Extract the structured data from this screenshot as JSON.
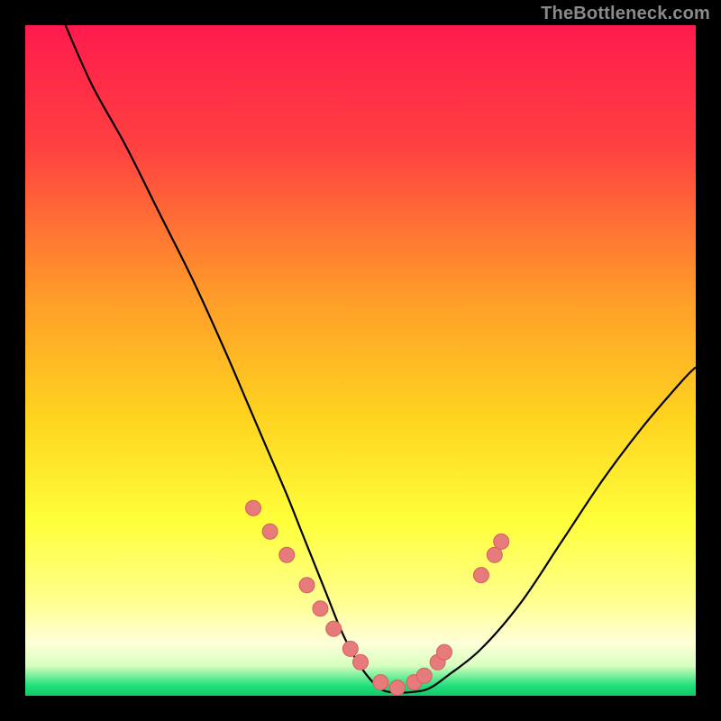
{
  "watermark": "TheBottleneck.com",
  "colors": {
    "bg_black": "#000000",
    "grad_top": "#ff1a4d",
    "grad_mid1": "#ff7a2a",
    "grad_mid2": "#ffd21f",
    "grad_mid3": "#ffff3a",
    "grad_light": "#ffffc0",
    "grad_green": "#1fe07a",
    "curve_stroke": "#000000",
    "marker_fill": "#e77a7a",
    "marker_stroke": "#d66060"
  },
  "chart_data": {
    "type": "line",
    "title": "",
    "xlabel": "",
    "ylabel": "",
    "xlim": [
      0,
      100
    ],
    "ylim": [
      0,
      100
    ],
    "x": [
      6,
      10,
      15,
      20,
      25,
      30,
      33,
      36,
      39,
      41,
      43,
      45,
      47,
      49,
      51,
      53,
      55,
      57,
      60,
      63,
      68,
      74,
      80,
      86,
      92,
      98,
      100
    ],
    "y": [
      100,
      91,
      82,
      72,
      62,
      51,
      44,
      37,
      30,
      25,
      20,
      15,
      10,
      6,
      3,
      1,
      0.5,
      0.5,
      1,
      3,
      7,
      14,
      23,
      32,
      40,
      47,
      49
    ],
    "markers_x": [
      34,
      36.5,
      39,
      42,
      44,
      46,
      48.5,
      50,
      53,
      55.5,
      58,
      59.5,
      61.5,
      62.5,
      68,
      70,
      71
    ],
    "markers_y": [
      28,
      24.5,
      21,
      16.5,
      13,
      10,
      7,
      5,
      2,
      1.2,
      2,
      3,
      5,
      6.5,
      18,
      21,
      23
    ],
    "gradient_stops": [
      {
        "offset": 0.0,
        "color": "#ff1a4d"
      },
      {
        "offset": 0.18,
        "color": "#ff4040"
      },
      {
        "offset": 0.4,
        "color": "#ff9a2a"
      },
      {
        "offset": 0.58,
        "color": "#ffd21f"
      },
      {
        "offset": 0.74,
        "color": "#ffff3a"
      },
      {
        "offset": 0.86,
        "color": "#ffff90"
      },
      {
        "offset": 0.92,
        "color": "#ffffd8"
      },
      {
        "offset": 0.955,
        "color": "#d8ffc0"
      },
      {
        "offset": 0.985,
        "color": "#1fe07a"
      },
      {
        "offset": 1.0,
        "color": "#14c86a"
      }
    ]
  }
}
